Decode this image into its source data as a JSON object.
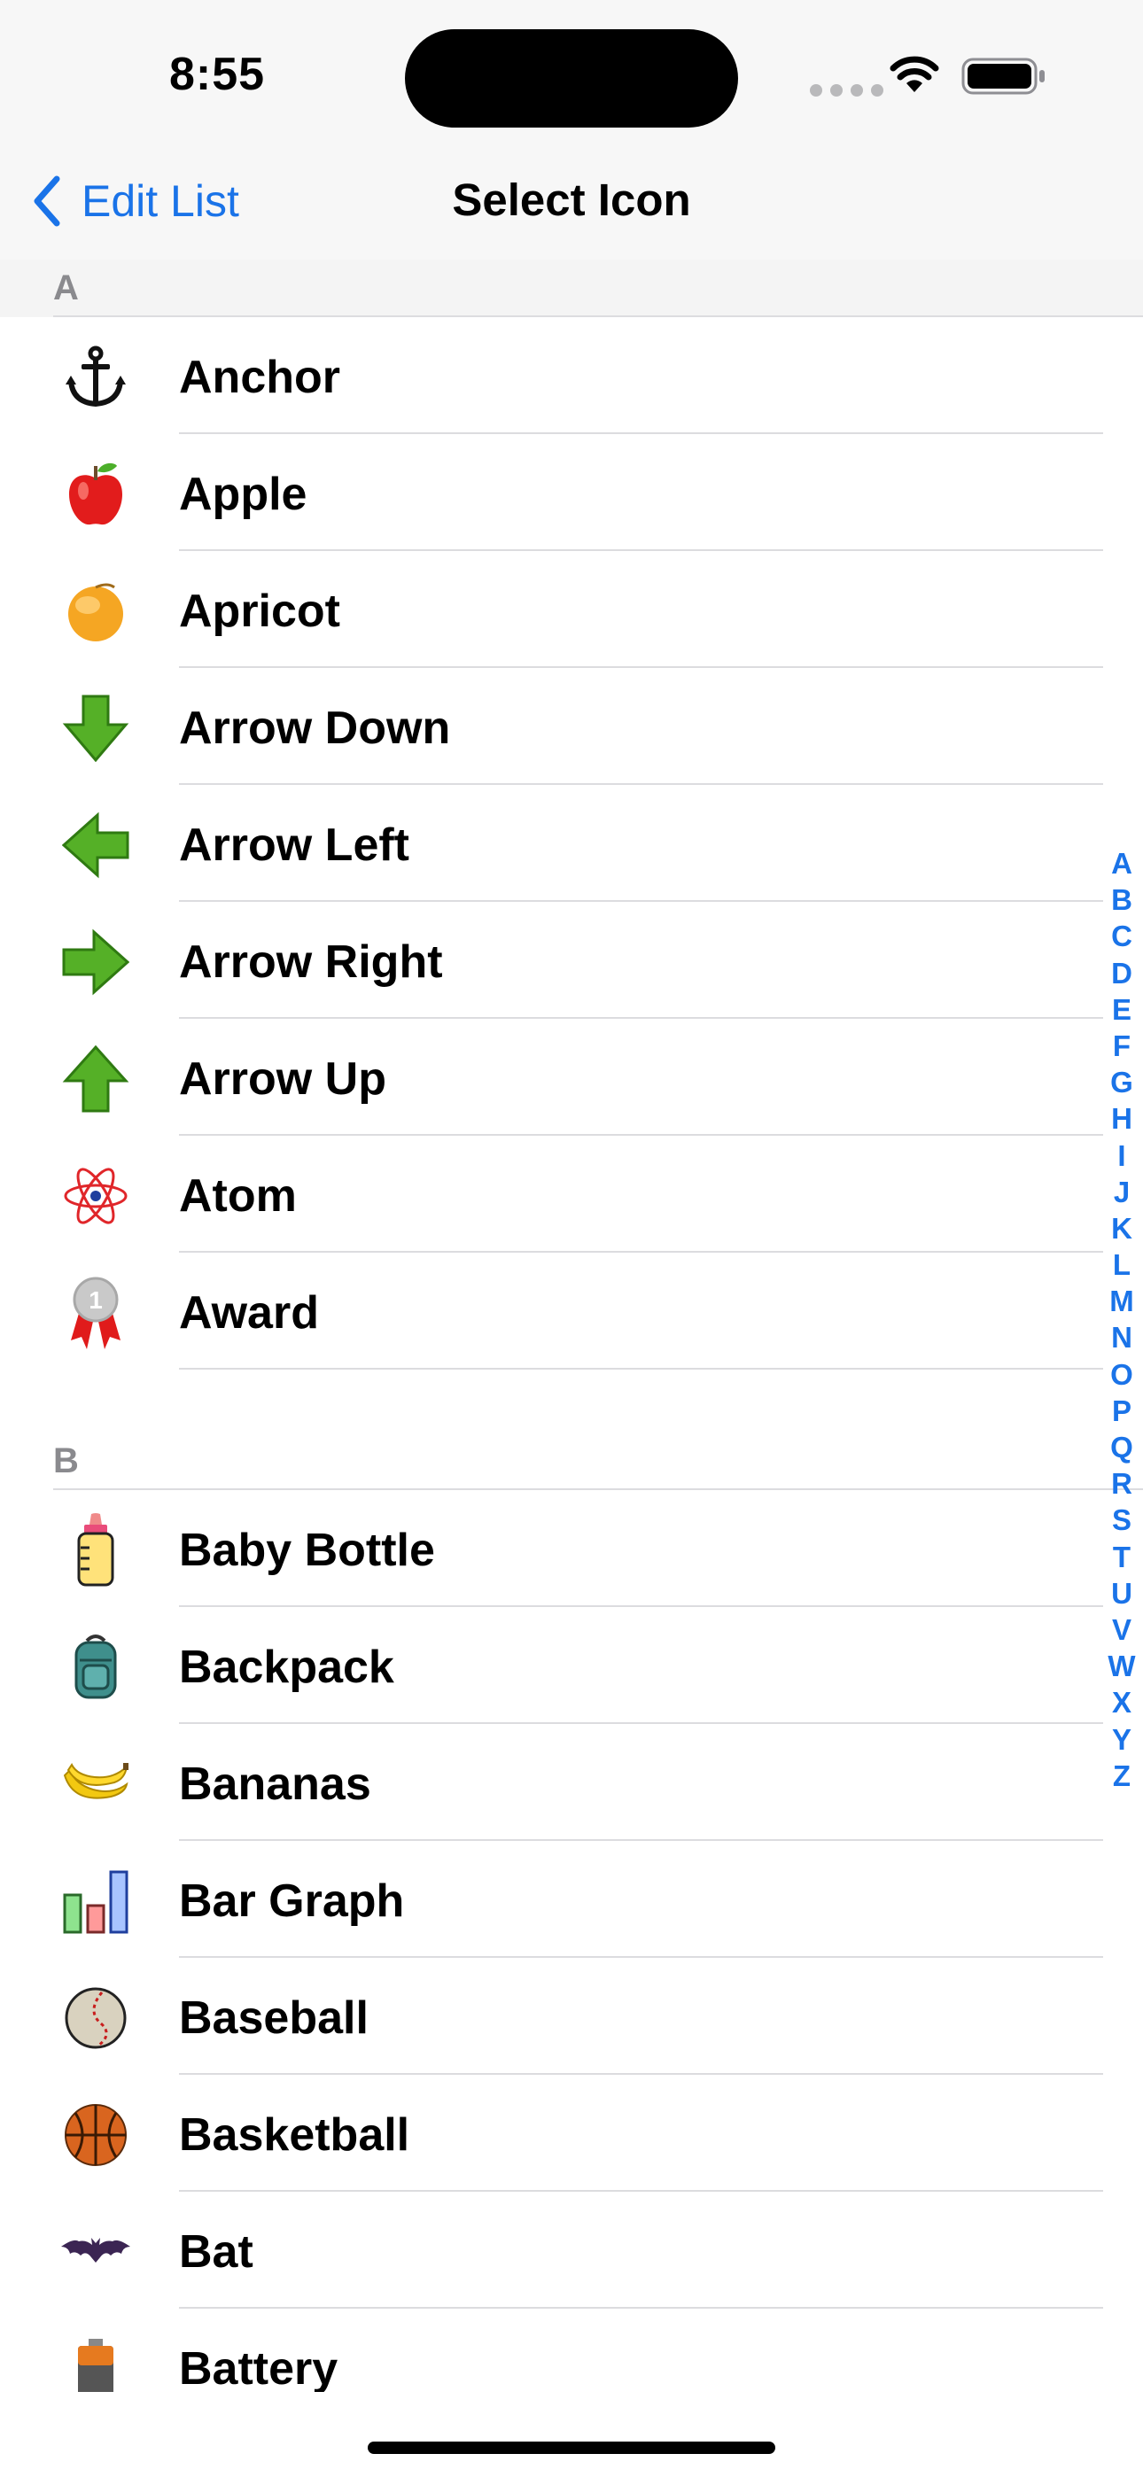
{
  "status_bar": {
    "time": "8:55"
  },
  "nav": {
    "back_label": "Edit List",
    "title": "Select Icon"
  },
  "sections": [
    {
      "letter": "A",
      "items": [
        {
          "label": "Anchor",
          "icon": "anchor-icon"
        },
        {
          "label": "Apple",
          "icon": "apple-icon"
        },
        {
          "label": "Apricot",
          "icon": "apricot-icon"
        },
        {
          "label": "Arrow Down",
          "icon": "arrow-down-icon"
        },
        {
          "label": "Arrow Left",
          "icon": "arrow-left-icon"
        },
        {
          "label": "Arrow Right",
          "icon": "arrow-right-icon"
        },
        {
          "label": "Arrow Up",
          "icon": "arrow-up-icon"
        },
        {
          "label": "Atom",
          "icon": "atom-icon"
        },
        {
          "label": "Award",
          "icon": "award-icon",
          "badge": "1"
        }
      ]
    },
    {
      "letter": "B",
      "items": [
        {
          "label": "Baby Bottle",
          "icon": "baby-bottle-icon"
        },
        {
          "label": "Backpack",
          "icon": "backpack-icon"
        },
        {
          "label": "Bananas",
          "icon": "bananas-icon"
        },
        {
          "label": "Bar Graph",
          "icon": "bar-graph-icon"
        },
        {
          "label": "Baseball",
          "icon": "baseball-icon"
        },
        {
          "label": "Basketball",
          "icon": "basketball-icon"
        },
        {
          "label": "Bat",
          "icon": "bat-icon"
        },
        {
          "label": "Battery",
          "icon": "battery-item-icon"
        }
      ]
    }
  ],
  "section_index": [
    "A",
    "B",
    "C",
    "D",
    "E",
    "F",
    "G",
    "H",
    "I",
    "J",
    "K",
    "L",
    "M",
    "N",
    "O",
    "P",
    "Q",
    "R",
    "S",
    "T",
    "U",
    "V",
    "W",
    "X",
    "Y",
    "Z"
  ],
  "colors": {
    "accent": "#1a73e8",
    "separator": "#dcdcdf",
    "header_bg": "#f4f4f4",
    "header_text": "#8a8a8e"
  }
}
